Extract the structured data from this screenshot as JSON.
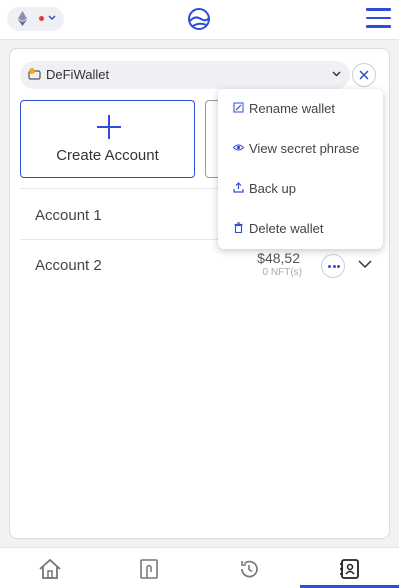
{
  "colors": {
    "accent": "#2f4dd9",
    "network_dot": "#e53935"
  },
  "header": {
    "network_icon": "ethereum-icon",
    "network_status_icon": "red-dot",
    "logo_icon": "wave-logo-icon",
    "menu_icon": "hamburger-menu-icon"
  },
  "wallet_selector": {
    "icon": "wallet-icon",
    "name": "DeFiWallet"
  },
  "actions": {
    "create_account_label": "Create Account"
  },
  "accounts": [
    {
      "name": "Account 1",
      "balance": "",
      "nft": ""
    },
    {
      "name": "Account 2",
      "balance": "$48,52",
      "nft": "0 NFT(s)"
    }
  ],
  "wallet_menu": {
    "items": [
      {
        "label": "Rename wallet",
        "icon": "edit-icon"
      },
      {
        "label": "View secret phrase",
        "icon": "eye-icon"
      },
      {
        "label": "Back up",
        "icon": "upload-icon"
      },
      {
        "label": "Delete wallet",
        "icon": "trash-icon"
      }
    ]
  },
  "bottom_nav": {
    "items": [
      {
        "name": "home",
        "icon": "home-icon"
      },
      {
        "name": "wallet",
        "icon": "wallet-card-icon"
      },
      {
        "name": "history",
        "icon": "history-icon"
      },
      {
        "name": "accounts",
        "icon": "contacts-icon",
        "active": true
      }
    ]
  }
}
